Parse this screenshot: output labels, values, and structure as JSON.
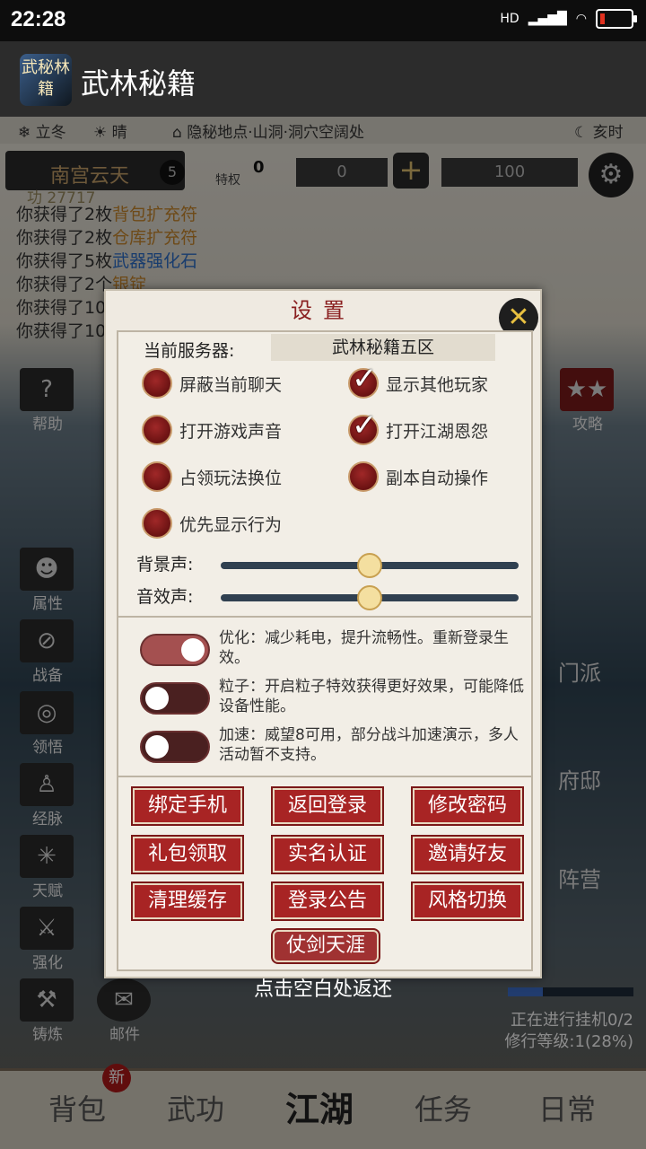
{
  "status_bar": {
    "time": "22:28",
    "network": "HD"
  },
  "app": {
    "title": "武林秘籍",
    "logo_text": "武秘林籍"
  },
  "info_bar": {
    "season": "立冬",
    "weather": "晴",
    "location": "隐秘地点·山洞·洞穴空阔处",
    "hour": "亥时"
  },
  "player": {
    "name": "南宫云天",
    "level": "5",
    "power": "27717",
    "privilege_label": "特权",
    "privilege_value": "0",
    "silver": "0",
    "gold": "100"
  },
  "log": {
    "lines": [
      {
        "prefix": "你获得了2枚",
        "item": "背包扩充符",
        "color": "orange"
      },
      {
        "prefix": "你获得了2枚",
        "item": "仓库扩充符",
        "color": "orange"
      },
      {
        "prefix": "你获得了5枚",
        "item": "武器强化石",
        "color": "blue"
      },
      {
        "prefix": "你获得了2个",
        "item": "银锭",
        "color": "orange"
      },
      {
        "prefix": "你获得了10",
        "item": "",
        "color": "orange"
      },
      {
        "prefix": "你获得了10",
        "item": "",
        "color": "orange"
      }
    ]
  },
  "left_buttons": {
    "help": "帮助",
    "attr": "属性",
    "equip": "战备",
    "insight": "领悟",
    "meridian": "经脉",
    "talent": "天赋",
    "enhance": "强化",
    "forge": "铸炼",
    "mail": "邮件"
  },
  "right_buttons": {
    "guide": "攻略",
    "sect": "门派",
    "mansion": "府邸",
    "camp": "阵营"
  },
  "idle": {
    "status": "正在进行挂机0/2",
    "level": "修行等级:1(28%)",
    "progress": 0.28
  },
  "bottom_nav": {
    "bag": "背包",
    "bag_badge": "新",
    "martial": "武功",
    "jianghu": "江湖",
    "task": "任务",
    "daily": "日常"
  },
  "settings": {
    "title": "设置",
    "server_label": "当前服务器:",
    "server_value": "武林秘籍五区",
    "options": [
      {
        "label": "屏蔽当前聊天",
        "checked": false
      },
      {
        "label": "显示其他玩家",
        "checked": true
      },
      {
        "label": "打开游戏声音",
        "checked": false
      },
      {
        "label": "打开江湖恩怨",
        "checked": true
      },
      {
        "label": "占领玩法换位",
        "checked": false
      },
      {
        "label": "副本自动操作",
        "checked": false
      },
      {
        "label": "优先显示行为",
        "checked": false
      }
    ],
    "bg_sound_label": "背景声:",
    "bg_sound_level": 0.5,
    "sfx_label": "音效声:",
    "sfx_level": 0.5,
    "toggles": [
      {
        "text": "优化：减少耗电，提升流畅性。重新登录生效。",
        "on": true
      },
      {
        "text": "粒子：开启粒子特效获得更好效果，可能降低设备性能。",
        "on": false
      },
      {
        "text": "加速：威望8可用，部分战斗加速演示，多人活动暂不支持。",
        "on": false
      }
    ],
    "buttons": {
      "bind_phone": "绑定手机",
      "back_login": "返回登录",
      "change_pwd": "修改密码",
      "gift": "礼包领取",
      "realname": "实名认证",
      "invite": "邀请好友",
      "clear_cache": "清理缓存",
      "announcement": "登录公告",
      "style": "风格切换",
      "wander": "仗剑天涯"
    }
  },
  "hint": "点击空白处返还"
}
